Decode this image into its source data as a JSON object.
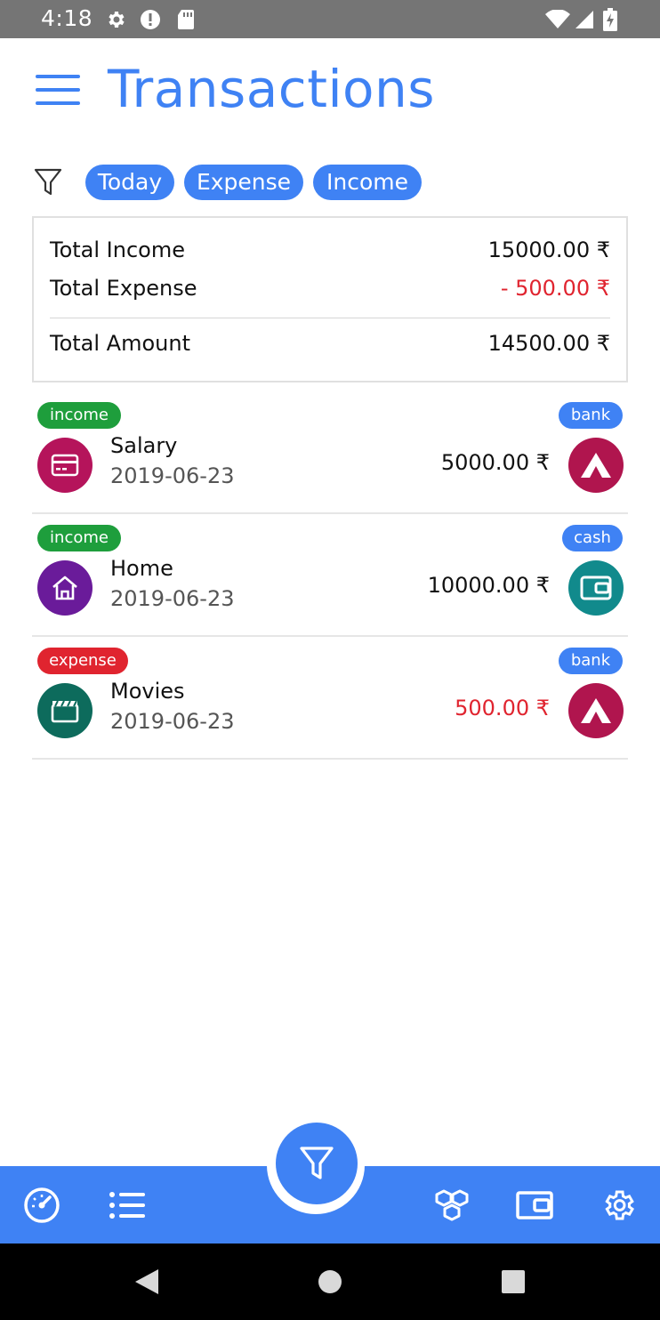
{
  "status_bar": {
    "time": "4:18",
    "left_icons": [
      "settings-gear-icon",
      "alert-icon",
      "sd-card-icon"
    ],
    "right_icons": [
      "wifi-icon",
      "cell-signal-icon",
      "battery-icon"
    ]
  },
  "header": {
    "title": "Transactions",
    "menu_icon": "hamburger-menu-icon"
  },
  "filters": {
    "icon": "filter-icon",
    "chips": [
      {
        "label": "Today"
      },
      {
        "label": "Expense"
      },
      {
        "label": "Income"
      }
    ]
  },
  "summary": {
    "income_label": "Total Income",
    "income_value": "15000.00 ₹",
    "expense_label": "Total Expense",
    "expense_value": "- 500.00 ₹",
    "amount_label": "Total Amount",
    "amount_value": "14500.00 ₹"
  },
  "transactions": [
    {
      "type": "income",
      "account": "bank",
      "name": "Salary",
      "date": "2019-06-23",
      "amount": "5000.00 ₹",
      "category_icon": "credit-card-icon",
      "account_icon": "bank-logo-icon"
    },
    {
      "type": "income",
      "account": "cash",
      "name": "Home",
      "date": "2019-06-23",
      "amount": "10000.00 ₹",
      "category_icon": "home-icon",
      "account_icon": "wallet-icon"
    },
    {
      "type": "expense",
      "account": "bank",
      "name": "Movies",
      "date": "2019-06-23",
      "amount": "500.00 ₹",
      "category_icon": "movie-clapper-icon",
      "account_icon": "bank-logo-icon"
    }
  ],
  "bottom_nav": {
    "items": [
      "dashboard-gauge-icon",
      "list-icon",
      "categories-cubes-icon",
      "wallet-icon",
      "settings-gear-icon"
    ],
    "fab_icon": "filter-icon"
  },
  "system_nav": [
    "back-icon",
    "home-icon",
    "recents-icon"
  ],
  "colors": {
    "accent": "#3f82f4",
    "income_tag": "#1e9e3c",
    "expense_tag": "#e0242f",
    "expense_text": "#e0242f",
    "salary_icon_bg": "#b5145b",
    "home_icon_bg": "#6a1b9a",
    "movies_icon_bg": "#0d6b5c",
    "bank_logo_bg": "#b0154e",
    "cash_icon_bg": "#118a8c"
  }
}
